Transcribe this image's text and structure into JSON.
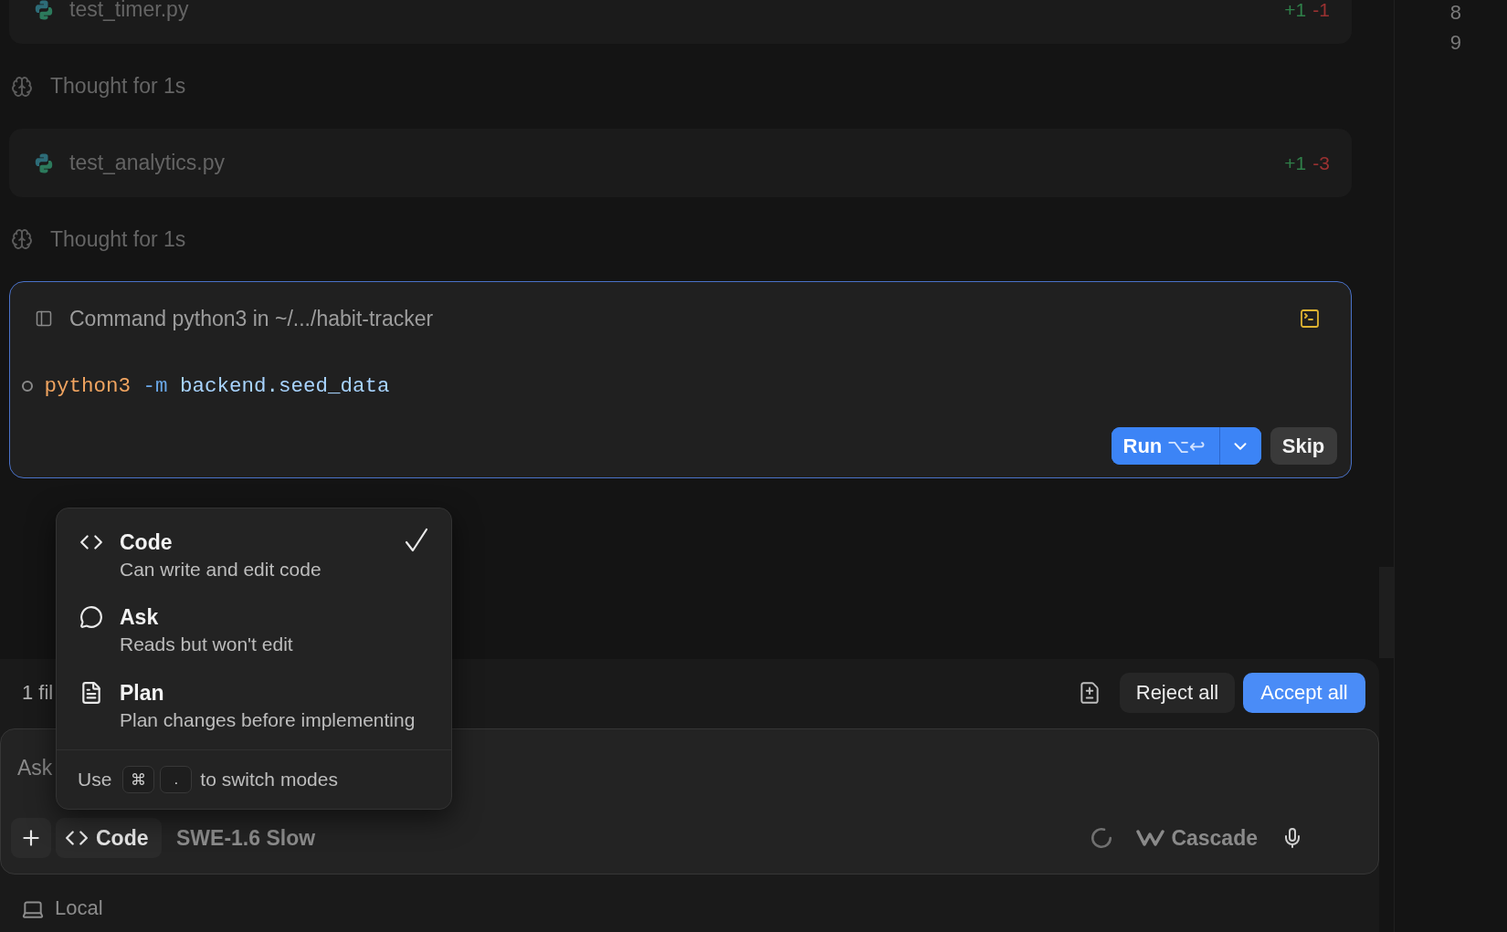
{
  "feed": [
    {
      "kind": "file",
      "name": "test_timer.py",
      "added": "+1",
      "removed": "-1"
    },
    {
      "kind": "thought",
      "label": "Thought for 1s"
    },
    {
      "kind": "file",
      "name": "test_analytics.py",
      "added": "+1",
      "removed": "-3"
    },
    {
      "kind": "thought",
      "label": "Thought for 1s"
    }
  ],
  "command": {
    "title": "Command python3 in ~/.../habit-tracker",
    "tokens": [
      {
        "kind": "program",
        "text": "python3"
      },
      {
        "kind": "flag",
        "text": "-m"
      },
      {
        "kind": "argument",
        "text": "backend.seed_data"
      }
    ],
    "run": {
      "label": "Run",
      "shortcut": "⌥↩"
    },
    "skip": "Skip"
  },
  "mode_menu": {
    "items": [
      {
        "title": "Code",
        "description": "Can write and edit code",
        "selected": true
      },
      {
        "title": "Ask",
        "description": "Reads but won't edit",
        "selected": false
      },
      {
        "title": "Plan",
        "description": "Plan changes before implementing",
        "selected": false
      }
    ],
    "hint": {
      "before": "Use",
      "keys": [
        "⌘",
        "."
      ],
      "after": "to switch modes"
    }
  },
  "changes_bar": {
    "summary": "1 fil",
    "reject": "Reject all",
    "accept": "Accept all"
  },
  "composer": {
    "placeholder": "Ask",
    "mode": "Code",
    "model": "SWE-1.6 Slow",
    "agent": "Cascade"
  },
  "workspace": "Local",
  "editor_gutter": {
    "line_numbers": [
      "8",
      "9"
    ]
  }
}
